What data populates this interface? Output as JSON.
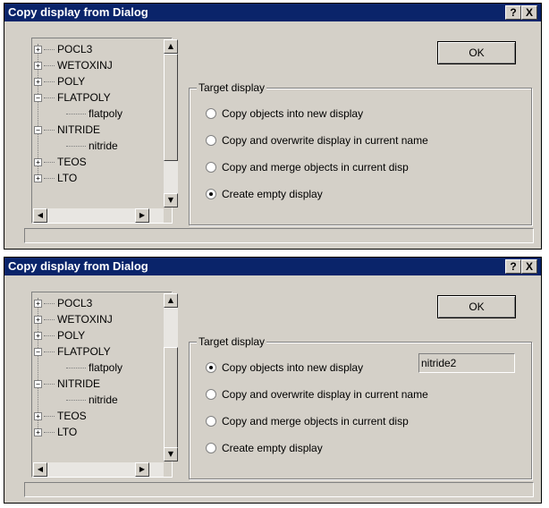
{
  "dialog_title": "Copy display from Dialog",
  "help_label": "?",
  "close_label": "X",
  "ok_label": "OK",
  "group_label": "Target display",
  "tree_items_1": [
    {
      "label": "POCL3",
      "expander": "+",
      "level": 0
    },
    {
      "label": "WETOXINJ",
      "expander": "+",
      "level": 0
    },
    {
      "label": "POLY",
      "expander": "+",
      "level": 0
    },
    {
      "label": "FLATPOLY",
      "expander": "−",
      "level": 0
    },
    {
      "label": "flatpoly",
      "expander": "",
      "level": 1
    },
    {
      "label": "NITRIDE",
      "expander": "−",
      "level": 0
    },
    {
      "label": "nitride",
      "expander": "",
      "level": 1
    },
    {
      "label": "TEOS",
      "expander": "+",
      "level": 0
    },
    {
      "label": "LTO",
      "expander": "+",
      "level": 0
    }
  ],
  "tree_items_2": [
    {
      "label": "POCL3",
      "expander": "+",
      "level": 0
    },
    {
      "label": "WETOXINJ",
      "expander": "+",
      "level": 0
    },
    {
      "label": "POLY",
      "expander": "+",
      "level": 0
    },
    {
      "label": "FLATPOLY",
      "expander": "−",
      "level": 0
    },
    {
      "label": "flatpoly",
      "expander": "",
      "level": 1
    },
    {
      "label": "NITRIDE",
      "expander": "−",
      "level": 0
    },
    {
      "label": "nitride",
      "expander": "",
      "level": 1
    },
    {
      "label": "TEOS",
      "expander": "+",
      "level": 0
    },
    {
      "label": "LTO",
      "expander": "+",
      "level": 0
    }
  ],
  "options": [
    "Copy objects into new display",
    "Copy and overwrite display in current name",
    "Copy and merge objects in current disp",
    "Create empty display"
  ],
  "dialog1": {
    "selected_option": 3
  },
  "dialog2": {
    "selected_option": 0,
    "name_value": "nitride2"
  },
  "colors": {
    "title_bar": "#0a246a",
    "face": "#d4d0c8"
  },
  "icons": {
    "up": "scroll-up-arrow-icon",
    "down": "scroll-down-arrow-icon",
    "left": "scroll-left-arrow-icon",
    "right": "scroll-right-arrow-icon"
  }
}
